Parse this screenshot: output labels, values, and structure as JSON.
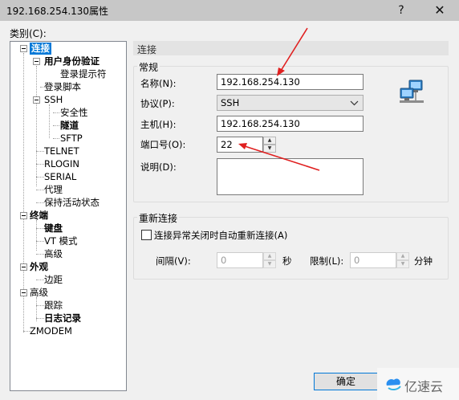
{
  "window": {
    "title": "192.168.254.130属性",
    "help_glyph": "?",
    "close_glyph": "✕"
  },
  "category_label": "类别(C):",
  "tree": {
    "connection": "连接",
    "user_auth": "用户身份验证",
    "login_prompt": "登录提示符",
    "login_script": "登录脚本",
    "ssh": "SSH",
    "security": "安全性",
    "tunnel": "隧道",
    "sftp": "SFTP",
    "telnet": "TELNET",
    "rlogin": "RLOGIN",
    "serial": "SERIAL",
    "proxy": "代理",
    "keepalive": "保持活动状态",
    "terminal": "终端",
    "keyboard": "键盘",
    "vt_mode": "VT 模式",
    "advanced": "高级",
    "appearance": "外观",
    "margin": "边距",
    "advanced2": "高级",
    "trace": "跟踪",
    "log": "日志记录",
    "zmodem": "ZMODEM"
  },
  "panel": {
    "title": "连接"
  },
  "general": {
    "title": "常规",
    "name_label": "名称(N):",
    "name_value": "192.168.254.130",
    "protocol_label": "协议(P):",
    "protocol_value": "SSH",
    "host_label": "主机(H):",
    "host_value": "192.168.254.130",
    "port_label": "端口号(O):",
    "port_value": "22",
    "desc_label": "说明(D):",
    "desc_value": ""
  },
  "reconnect": {
    "title": "重新连接",
    "checkbox_label": "连接异常关闭时自动重新连接(A)",
    "checked": false,
    "interval_label": "间隔(V):",
    "interval_value": "0",
    "seconds_unit": "秒",
    "limit_label": "限制(L):",
    "limit_value": "0",
    "minutes_unit": "分钟"
  },
  "buttons": {
    "ok": "确定"
  },
  "watermark": {
    "text": "亿速云"
  },
  "colors": {
    "selection": "#0078d7",
    "annotation_arrow": "#e02020"
  }
}
